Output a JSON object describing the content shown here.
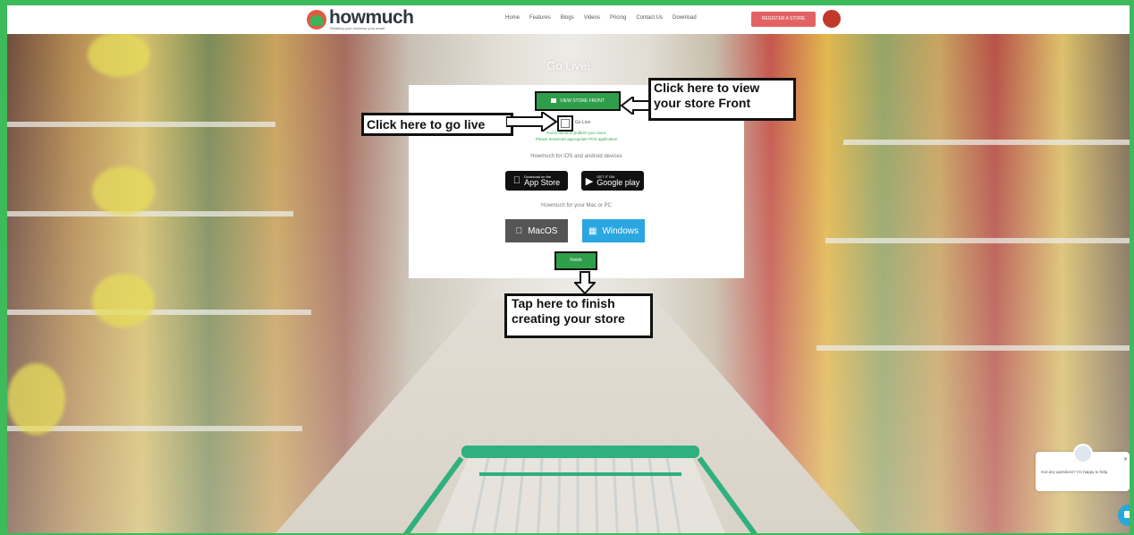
{
  "brand": {
    "name": "howmuch",
    "tagline": "Retailing your business your smart"
  },
  "nav": {
    "items": [
      "Home",
      "Features",
      "Blogs",
      "Videos",
      "Pricing",
      "Contact Us",
      "Download"
    ],
    "register_label": "REGISTER A STORE"
  },
  "page_title": "Go Live!",
  "modal": {
    "store_front_label": "VIEW STORE FRONT",
    "live_label": "Go Live",
    "info_line1": "You're about to publish your store.",
    "info_line2": "Please download appropriate POS application",
    "devices_text": "Howmuch for iOS and android devices",
    "app_store_small": "Download on the",
    "app_store_label": "App Store",
    "google_play_small": "GET IT ON",
    "google_play_label": "Google play",
    "desktop_text": "Howmuch for your Mac or PC",
    "macos_label": "MacOS",
    "windows_label": "Windows",
    "finish_label": "Finish"
  },
  "callouts": {
    "go_live": "Click here to go live",
    "store_front_line1": "Click here to view",
    "store_front_line2": "your store Front",
    "finish_line1": "Tap here to finish",
    "finish_line2": "creating your store"
  },
  "chat": {
    "message": "Got any questions? I'm happy to help."
  },
  "colors": {
    "green": "#2f9e4a",
    "register": "#e36364",
    "windows": "#2aa7e0",
    "frame": "#3dba5a"
  }
}
